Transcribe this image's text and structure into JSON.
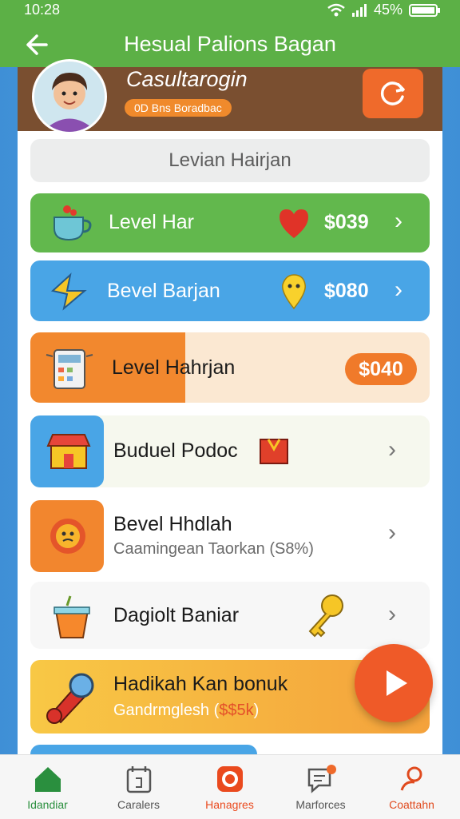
{
  "status": {
    "time": "10:28",
    "battery": "45%"
  },
  "header": {
    "title": "Hesual Palions Bagan"
  },
  "profile": {
    "name": "Casultarogin",
    "badge": "0D Bns Boradbac"
  },
  "search": {
    "label": "Levian Hairjan"
  },
  "rows": [
    {
      "label": "Level Har",
      "price": "$039"
    },
    {
      "label": "Bevel Barjan",
      "price": "$080"
    },
    {
      "label": "Level Hahrjan",
      "price": "$040"
    },
    {
      "label": "Buduel Podoc"
    },
    {
      "label": "Bevel Hhdlah",
      "sub": "Caamingean Taorkan (S8%)"
    },
    {
      "label": "Dagiolt Baniar"
    },
    {
      "label": "Hadikah Kan bonuk",
      "sub_prefix": "Gandrmglesh (",
      "sub_highlight": "$$5k",
      "sub_suffix": ")"
    }
  ],
  "nav": [
    {
      "label": "Idandiar",
      "color": "#2a8f3e"
    },
    {
      "label": "Caralers",
      "color": "#555555"
    },
    {
      "label": "Hanagres",
      "color": "#ea4a1e"
    },
    {
      "label": "Marforces",
      "color": "#555555"
    },
    {
      "label": "Coattahn",
      "color": "#e04a1e"
    }
  ],
  "colors": {
    "green": "#5cb046",
    "blue": "#4aa6e6",
    "orange": "#f08a2c"
  }
}
